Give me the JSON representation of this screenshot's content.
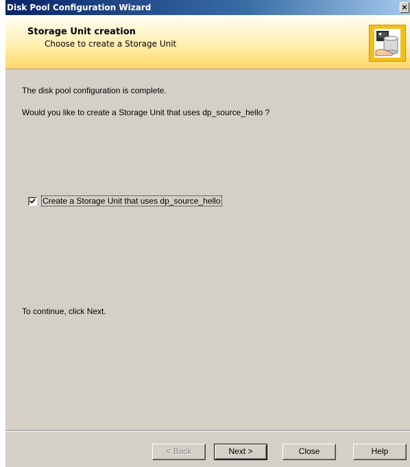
{
  "window": {
    "title": "Disk Pool Configuration Wizard",
    "close_label": "×"
  },
  "header": {
    "title": "Storage Unit creation",
    "subtitle": "Choose to create a Storage Unit",
    "icon": "storage-unit-icon"
  },
  "content": {
    "line1": "The disk pool configuration is complete.",
    "line2": "Would you like to create a Storage Unit that uses dp_source_hello ?",
    "checkbox_label": "Create a Storage Unit that uses dp_source_hello",
    "checkbox_checked": true,
    "continue_text": "To continue, click Next."
  },
  "buttons": {
    "back": "< Back",
    "next": "Next >",
    "close": "Close",
    "help": "Help"
  },
  "colors": {
    "titlebar": "#0a246a",
    "dialog_bg": "#d4d0c8",
    "header_bg": "#ffd768"
  }
}
